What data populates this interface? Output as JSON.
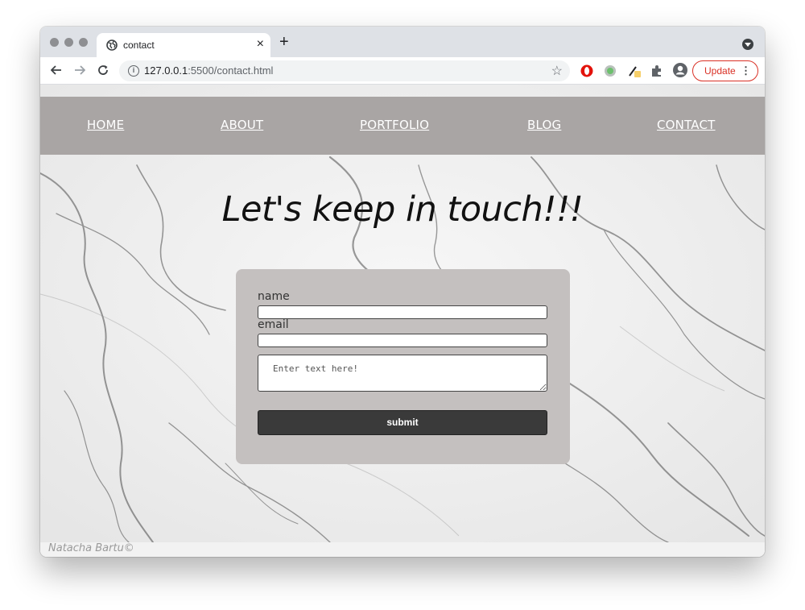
{
  "browser": {
    "tab_title": "contact",
    "tab_close": "×",
    "new_tab": "+",
    "url_host": "127.0.0.1",
    "url_rest": ":5500/contact.html",
    "update_label": "Update",
    "menu_dots": "⋮"
  },
  "nav": {
    "items": [
      {
        "label": "HOME"
      },
      {
        "label": "ABOUT"
      },
      {
        "label": "PORTFOLIO"
      },
      {
        "label": "BLOG"
      },
      {
        "label": "CONTACT"
      }
    ]
  },
  "main": {
    "heading": "Let's keep in touch!!!",
    "form": {
      "name_label": "name",
      "name_value": "",
      "email_label": "email",
      "email_value": "",
      "message_placeholder": "Enter text here!",
      "submit_label": "submit"
    }
  },
  "footer": {
    "text": "Natacha Bartu©"
  },
  "colors": {
    "nav_bg": "#a9a5a4",
    "form_bg": "#c4c0bf",
    "submit_bg": "#3a3a3a",
    "update_red": "#d93025"
  }
}
